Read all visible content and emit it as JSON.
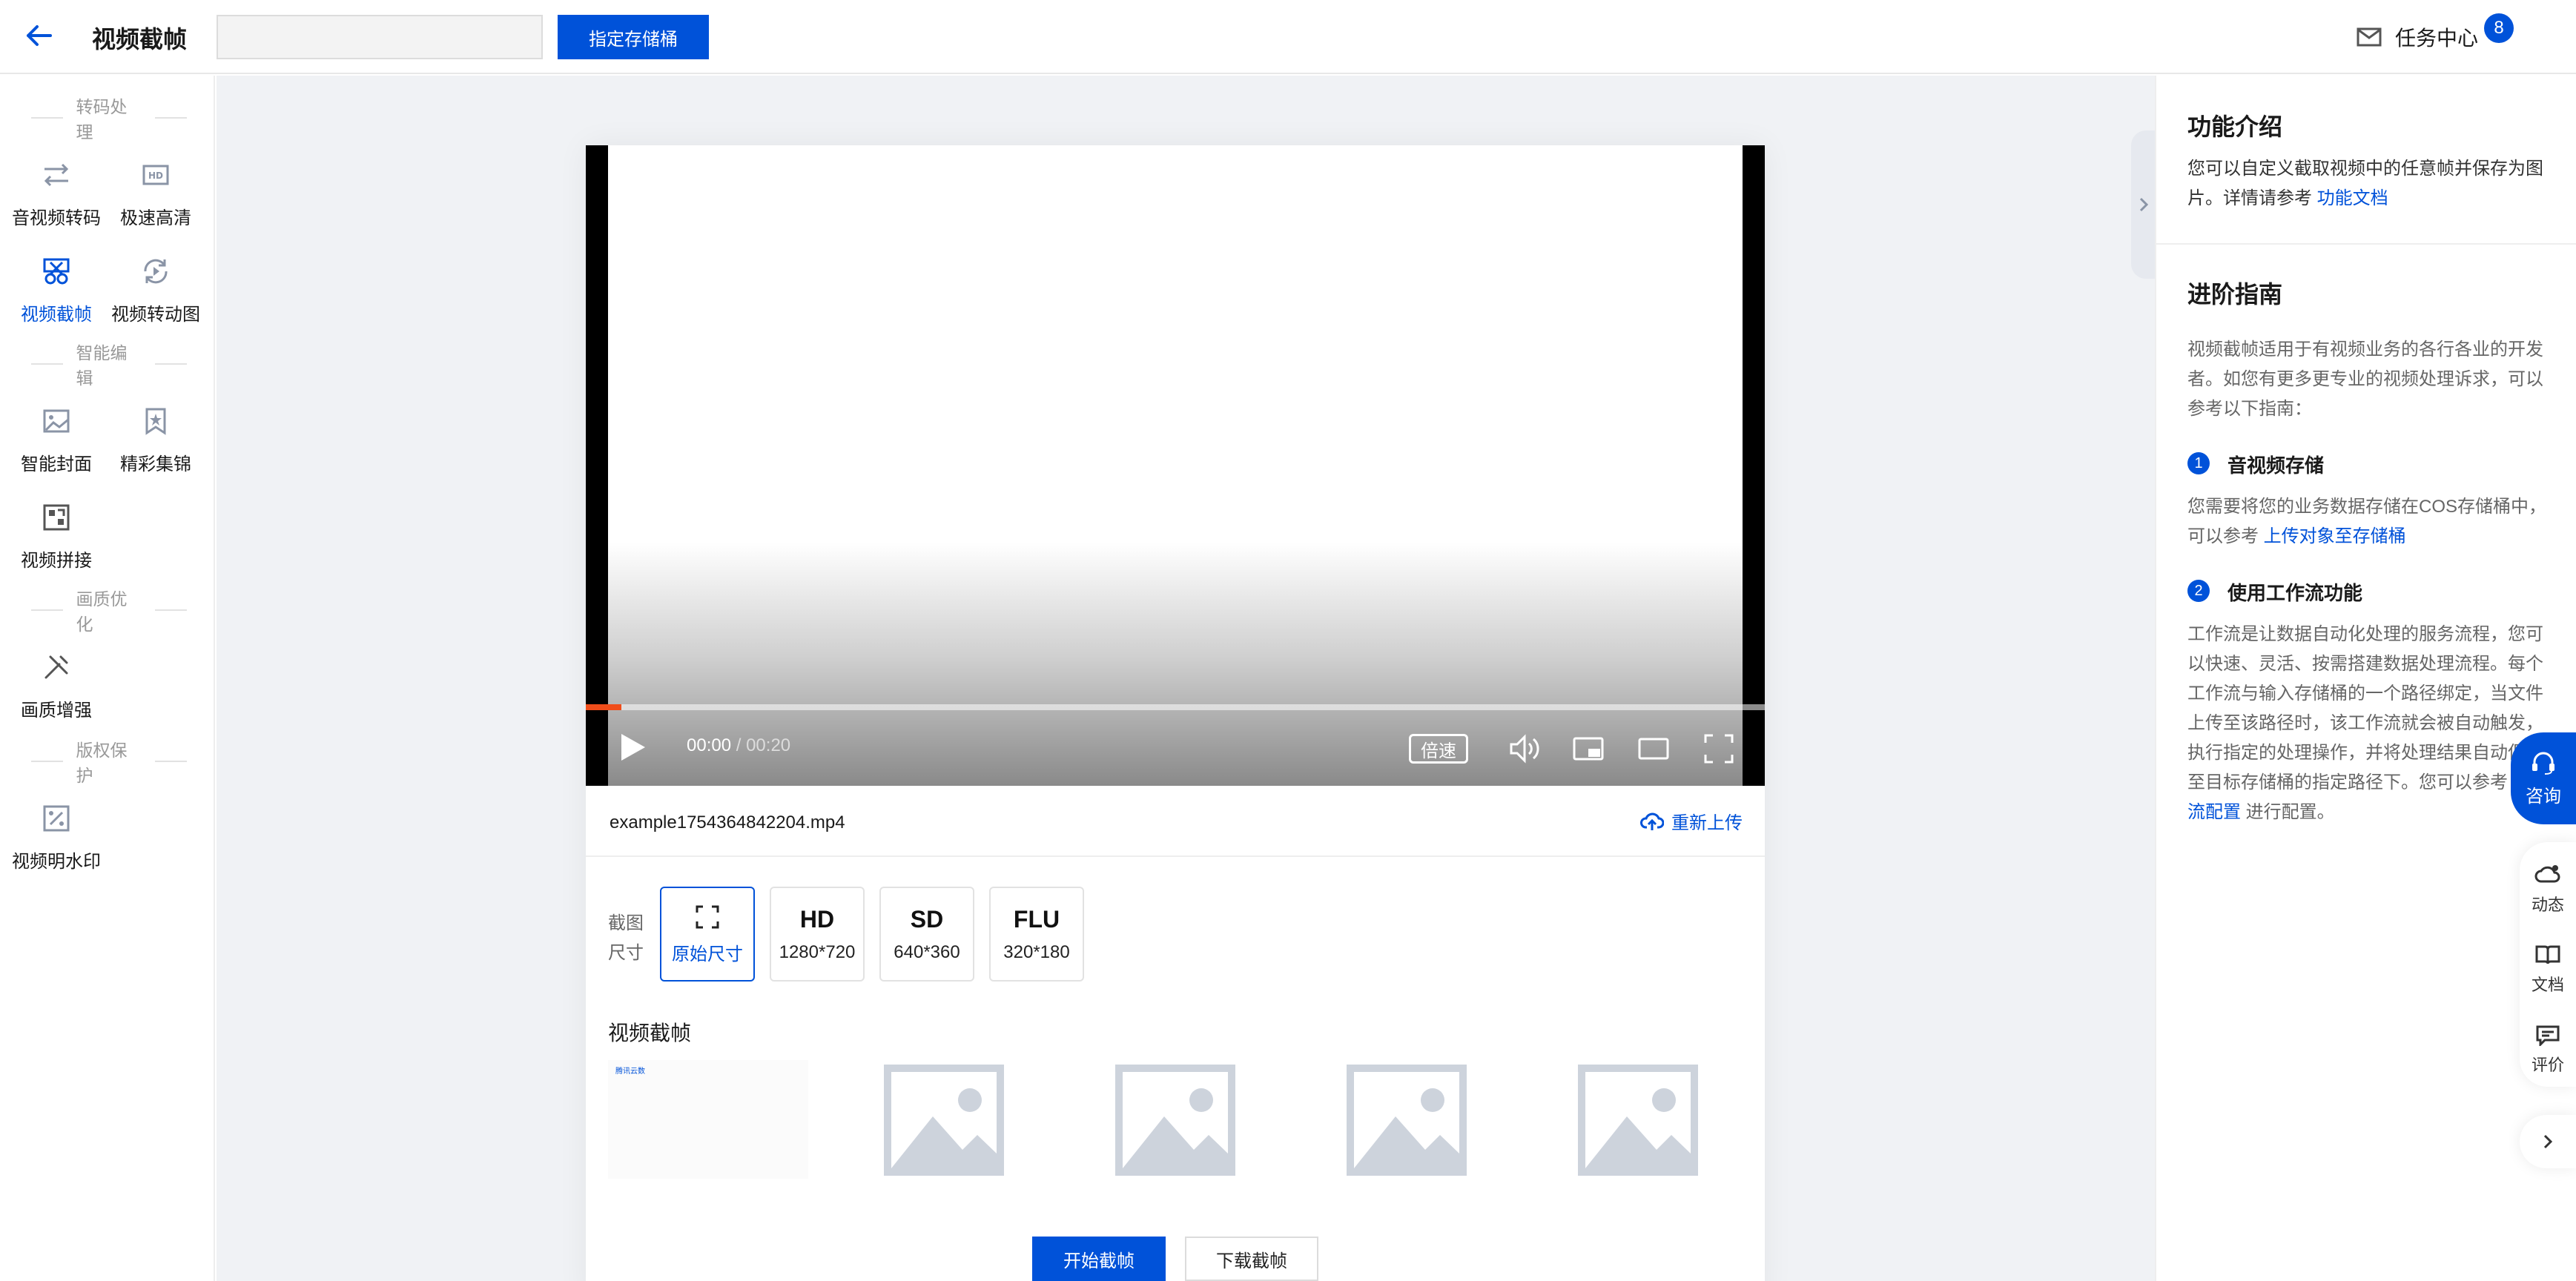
{
  "header": {
    "title": "视频截帧",
    "bucket_placeholder": "",
    "specify_bucket": "指定存储桶",
    "task_center": "任务中心",
    "task_count": "8"
  },
  "sidebar": {
    "sections": [
      {
        "title": "转码处理",
        "items": [
          {
            "label": "音视频转码",
            "icon": "transcode-icon"
          },
          {
            "label": "极速高清",
            "icon": "hd-icon"
          },
          {
            "label": "视频截帧",
            "icon": "scissors-icon",
            "active": true
          },
          {
            "label": "视频转动图",
            "icon": "gif-convert-icon"
          }
        ]
      },
      {
        "title": "智能编辑",
        "items": [
          {
            "label": "智能封面",
            "icon": "image-icon"
          },
          {
            "label": "精彩集锦",
            "icon": "bookmark-star-icon"
          },
          {
            "label": "视频拼接",
            "icon": "splice-icon"
          }
        ]
      },
      {
        "title": "画质优化",
        "items": [
          {
            "label": "画质增强",
            "icon": "tools-icon"
          }
        ]
      },
      {
        "title": "版权保护",
        "items": [
          {
            "label": "视频明水印",
            "icon": "watermark-icon"
          }
        ]
      }
    ]
  },
  "player": {
    "current_time": "00:00",
    "separator": " / ",
    "duration": "00:20",
    "progress": 0.03,
    "speed_label": "倍速"
  },
  "file": {
    "name": "example1754364842204.mp4",
    "reupload": "重新上传"
  },
  "size_options": {
    "label": "截图尺寸",
    "options": [
      {
        "title": "",
        "subtitle": "原始尺寸",
        "active": true
      },
      {
        "title": "HD",
        "subtitle": "1280*720"
      },
      {
        "title": "SD",
        "subtitle": "640*360"
      },
      {
        "title": "FLU",
        "subtitle": "320*180"
      }
    ]
  },
  "frames": {
    "title": "视频截帧",
    "first_frame_text": "腾讯云数"
  },
  "actions": {
    "start": "开始截帧",
    "download": "下载截帧"
  },
  "right_panel": {
    "intro_title": "功能介绍",
    "intro_text": "您可以自定义截取视频中的任意帧并保存为图片。详情请参考",
    "intro_link": "功能文档",
    "guide_title": "进阶指南",
    "guide_text": "视频截帧适用于有视频业务的各行各业的开发者。如您有更多更专业的视频处理诉求，可以参考以下指南：",
    "step1_num": "1",
    "step1_title": "音视频存储",
    "step1_text": "您需要将您的业务数据存储在COS存储桶中，可以参考",
    "step1_link": "上传对象至存储桶",
    "step2_num": "2",
    "step2_title": "使用工作流功能",
    "step2_text": "工作流是让数据自动化处理的服务流程，您可以快速、灵活、按需搭建数据处理流程。每个工作流与输入存储桶的一个路径绑定，当文件上传至该路径时，该工作流就会被自动触发，执行指定的处理操作，并将处理结果自动保存至目标存储桶的指定路径下。您可以参考",
    "step2_link": "工作流配置",
    "step2_tail": "进行配置。"
  },
  "float_tools": {
    "consult": "咨询",
    "items": [
      {
        "label": "动态"
      },
      {
        "label": "文档"
      },
      {
        "label": "评价"
      }
    ]
  },
  "colors": {
    "primary": "#0052d9",
    "progress": "#f04d1a"
  }
}
